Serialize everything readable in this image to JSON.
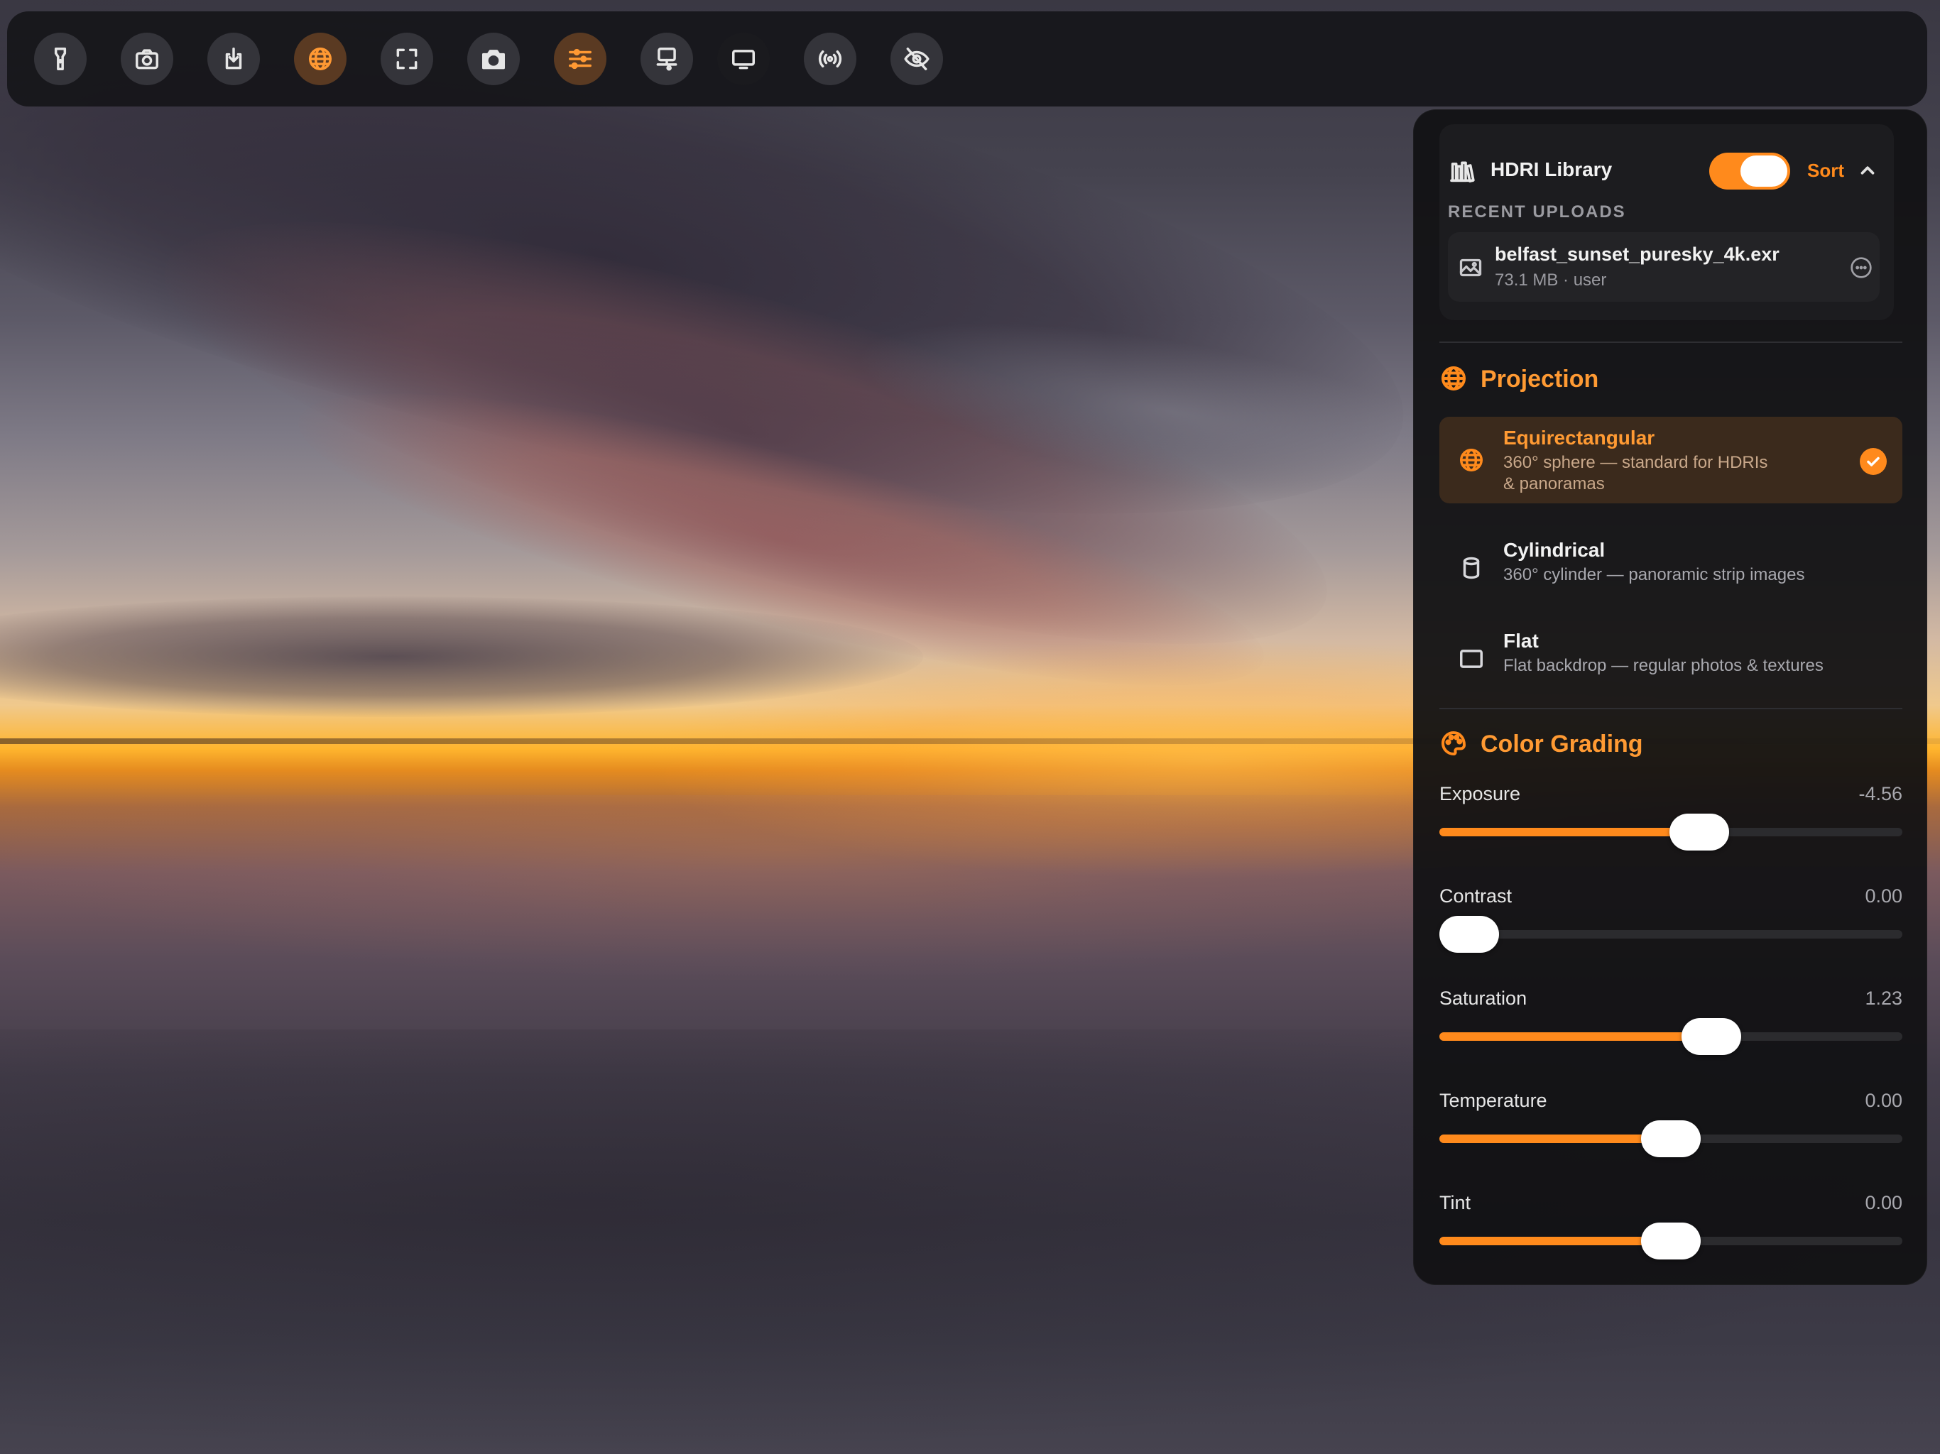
{
  "toolbar": {
    "buttons": [
      {
        "icon": "flashlight-icon",
        "active": false
      },
      {
        "icon": "camera-outline-icon",
        "active": false
      },
      {
        "icon": "download-icon",
        "active": false
      },
      {
        "icon": "globe-icon",
        "active": true
      },
      {
        "icon": "fullscreen-icon",
        "active": false
      },
      {
        "icon": "camera-icon",
        "active": false
      },
      {
        "icon": "sliders-icon",
        "active": true
      },
      {
        "icon": "display-settings-icon",
        "active": false
      },
      {
        "icon": "monitor-icon",
        "active": false
      },
      {
        "icon": "broadcast-icon",
        "active": false
      },
      {
        "icon": "eye-slash-icon",
        "active": false
      }
    ]
  },
  "library": {
    "title": "HDRI Library",
    "toggle_on": true,
    "sort_label": "Sort",
    "recent_label": "RECENT UPLOADS",
    "file": {
      "name": "belfast_sunset_puresky_4k.exr",
      "meta": "73.1 MB · user"
    }
  },
  "projection": {
    "title": "Projection",
    "options": [
      {
        "title": "Equirectangular",
        "desc_line1": "360° sphere — standard for HDRIs",
        "desc_line2": "& panoramas",
        "selected": true
      },
      {
        "title": "Cylindrical",
        "desc_line1": "360° cylinder — panoramic strip images",
        "desc_line2": "",
        "selected": false
      },
      {
        "title": "Flat",
        "desc_line1": "Flat backdrop — regular photos & textures",
        "desc_line2": "",
        "selected": false
      }
    ]
  },
  "color_grading": {
    "title": "Color Grading",
    "sliders": [
      {
        "label": "Exposure",
        "value": "-4.56",
        "fraction": 0.57
      },
      {
        "label": "Contrast",
        "value": "0.00",
        "fraction": 0.0
      },
      {
        "label": "Saturation",
        "value": "1.23",
        "fraction": 0.6
      },
      {
        "label": "Temperature",
        "value": "0.00",
        "fraction": 0.5
      },
      {
        "label": "Tint",
        "value": "0.00",
        "fraction": 0.5
      }
    ]
  },
  "colors": {
    "accent": "#ff8a1c",
    "panel_bg": "#121214",
    "selected_bg": "#3b2a1c"
  }
}
